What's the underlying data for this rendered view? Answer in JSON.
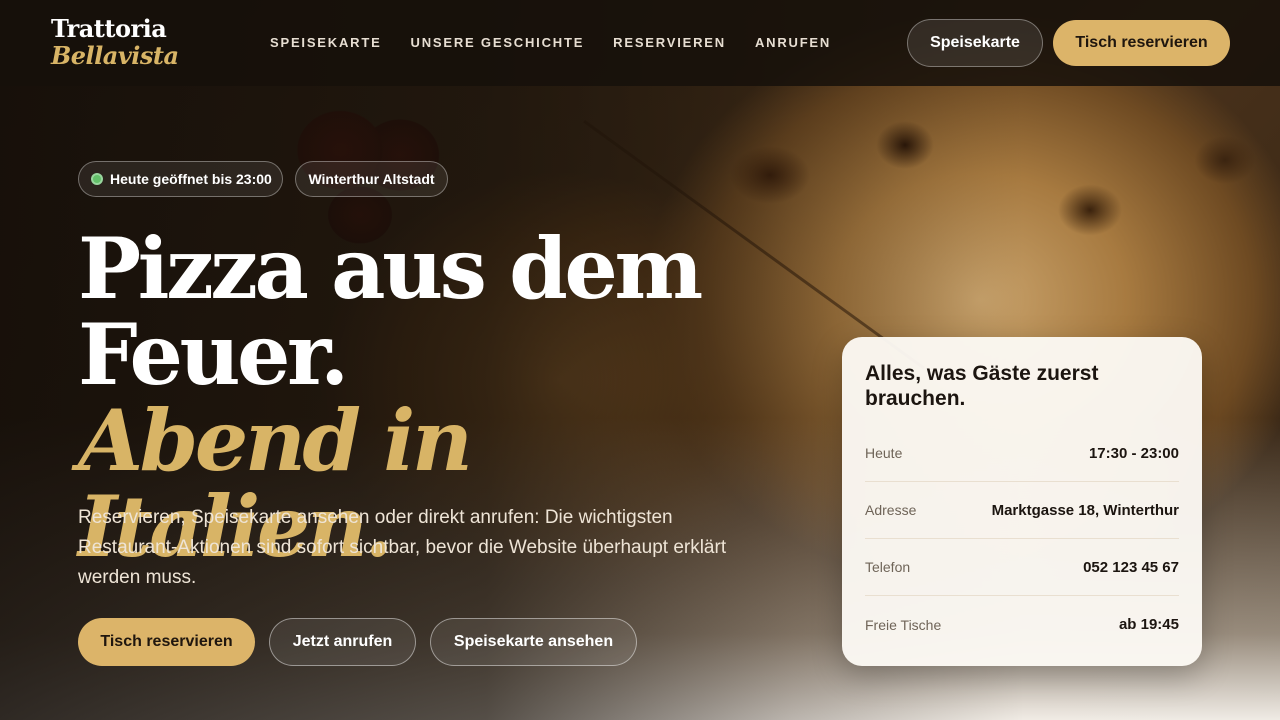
{
  "header": {
    "logo_line1": "Trattoria",
    "logo_line2": "Bellavista",
    "nav": [
      "SPEISEKARTE",
      "UNSERE GESCHICHTE",
      "RESERVIEREN",
      "ANRUFEN"
    ],
    "menu_button": "Speisekarte",
    "reserve_button": "Tisch reservieren"
  },
  "hero": {
    "badge_open": "Heute geöffnet bis 23:00",
    "badge_location": "Winterthur Altstadt",
    "headline_line1": "Pizza aus dem",
    "headline_line2": "Feuer.",
    "headline_line3": "Abend in Italien.",
    "lead": "Reservieren, Speisekarte ansehen oder direkt anrufen: Die wichtigsten Restaurant-Aktionen sind sofort sichtbar, bevor die Website überhaupt erklärt werden muss.",
    "cta_reserve": "Tisch reservieren",
    "cta_call": "Jetzt anrufen",
    "cta_menu": "Speisekarte ansehen"
  },
  "info_card": {
    "title": "Alles, was Gäste zuerst brauchen.",
    "rows": [
      {
        "label": "Heute",
        "value": "17:30 - 23:00"
      },
      {
        "label": "Adresse",
        "value": "Marktgasse 18, Winterthur"
      },
      {
        "label": "Telefon",
        "value": "052 123 45 67"
      },
      {
        "label": "Freie Tische",
        "value": "ab 19:45"
      }
    ]
  },
  "colors": {
    "accent_gold": "#dcb469",
    "status_green": "#63c06a",
    "header_bg": "#16100b"
  }
}
